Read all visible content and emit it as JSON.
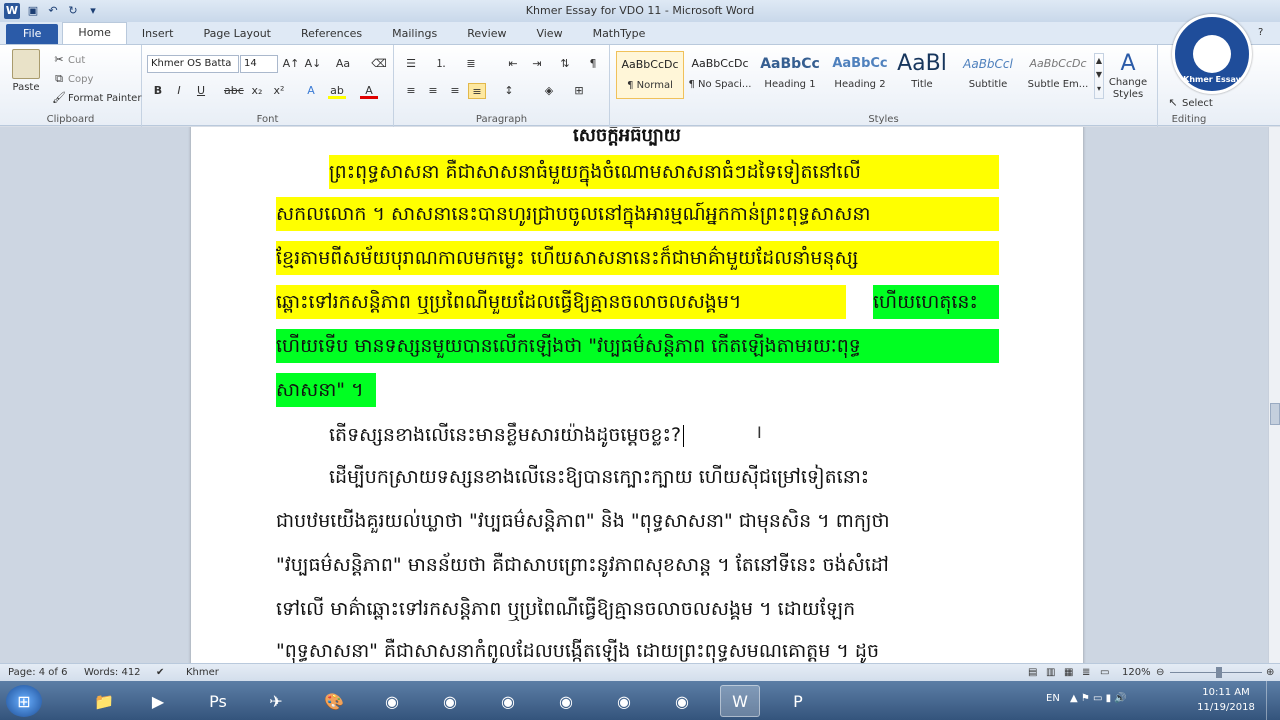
{
  "window": {
    "title": "Khmer Essay for VDO 11  -  Microsoft Word"
  },
  "tabs": [
    "File",
    "Home",
    "Insert",
    "Page Layout",
    "References",
    "Mailings",
    "Review",
    "View",
    "MathType"
  ],
  "clipboard": {
    "paste": "Paste",
    "cut": "Cut",
    "copy": "Copy",
    "format_painter": "Format Painter",
    "label": "Clipboard"
  },
  "font": {
    "name": "Khmer OS Batta",
    "size": "14",
    "label": "Font"
  },
  "paragraph": {
    "label": "Paragraph"
  },
  "styles": {
    "items": [
      {
        "preview": "AaBbCcDc",
        "name": "¶ Normal"
      },
      {
        "preview": "AaBbCcDc",
        "name": "¶ No Spaci..."
      },
      {
        "preview": "AaBbCc",
        "name": "Heading 1"
      },
      {
        "preview": "AaBbCc",
        "name": "Heading 2"
      },
      {
        "preview": "AaBl",
        "name": "Title"
      },
      {
        "preview": "AaBbCcl",
        "name": "Subtitle"
      },
      {
        "preview": "AaBbCcDc",
        "name": "Subtle Em..."
      }
    ],
    "change_styles": "Change Styles",
    "label": "Styles"
  },
  "editing": {
    "select": "Select",
    "label": "Editing"
  },
  "logo": {
    "text": "Khmer Essay"
  },
  "document": {
    "heading": "សេចក្ដីអធិប្បាយ",
    "lines": [
      "ព្រះពុទ្ធសាសនា     គឺជាសាសនាធំមួយក្នុងចំណោមសាសនាធំៗដទៃទៀតនៅលើ",
      "សកលលោក ។ សាសនានេះបានហូរជ្រាបចូលនៅក្នុងអារម្មណ៍អ្នកកាន់ព្រះពុទ្ធសាសនា",
      "ខ្មែរតាមពីសម័យបុរាណកាលមកម្លេះ     ហើយសាសនានេះក៏ជាមាគ៌ាមួយដែលនាំមនុស្ស",
      "ឆ្ពោះទៅរកសន្តិភាព   ឬប្រពៃណីមួយដែលធ្វើឱ្យគ្មានចលាចលសង្គម។",
      "ហើយហេតុនេះ",
      "ហើយទើប  មានទស្សនមួយបានលើកឡើងថា  \"វប្បធម៌សន្តិភាព  កើតឡើងតាមរយៈពុទ្ធ",
      "សាសនា\" ។",
      "តើទស្សនខាងលើនេះមានខ្លឹមសារយ៉ាងដូចម្ដេចខ្លះ?",
      "ដើម្បីបកស្រាយទស្សនខាងលើនេះឱ្យបានក្បោះក្បាយ     ហើយស៊ីជម្រៅទៀតនោះ",
      "ជាបឋមយើងគួរយល់ឃ្លាថា \"វប្បធម៌សន្តិភាព\" និង \"ពុទ្ធសាសនា\" ជាមុនសិន ។ ពាក្យថា",
      "\"វប្បធម៌សន្តិភាព\" មានន័យថា គឺជាសាបព្រោះនូវភាពសុខសាន្ត ។ តែនៅទីនេះ ចង់សំដៅ",
      "ទៅលើ  មាគ៌ាឆ្ពោះទៅរកសន្តិភាព  ឬប្រពៃណីធ្វើឱ្យគ្មានចលាចលសង្គម  ។  ដោយឡែក",
      "\"ពុទ្ធសាសនា\" គឺជាសាសនាកំពូលដែលបង្កើតឡើង ដោយព្រះពុទ្ធសមណគោត្តម ។ ដូច"
    ]
  },
  "status": {
    "page": "Page: 4 of 6",
    "words": "Words: 412",
    "language": "Khmer",
    "zoom": "120%"
  },
  "taskbar": {
    "language": "EN",
    "time": "10:11 AM",
    "date": "11/19/2018"
  }
}
